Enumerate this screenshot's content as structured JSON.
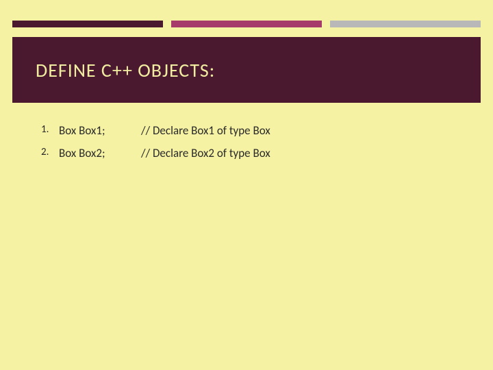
{
  "colors": {
    "background": "#f5f2a3",
    "stripe_dark": "#4a1930",
    "stripe_magenta": "#a53a6b",
    "stripe_gray": "#b8b8b8",
    "title_bg": "#4a1930",
    "title_fg": "#f0eca0",
    "body_text": "#2a2a2a"
  },
  "title": "DEFINE C++ OBJECTS:",
  "items": [
    {
      "code": "Box Box1;",
      "comment": "// Declare Box1 of type Box"
    },
    {
      "code": "Box Box2;",
      "comment": "// Declare Box2 of type Box"
    }
  ]
}
